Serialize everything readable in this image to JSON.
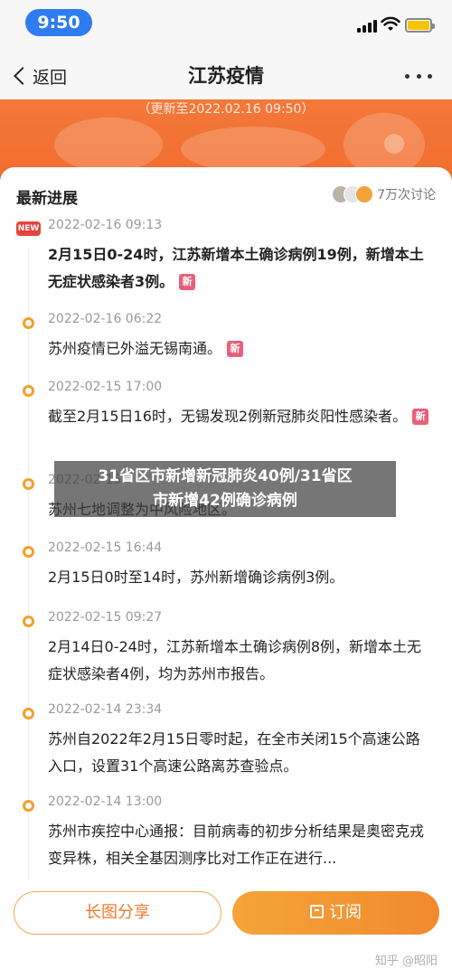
{
  "status_bar": {
    "time": "9:50"
  },
  "nav": {
    "back_label": "返回",
    "title": "江苏疫情"
  },
  "header": {
    "update_note": "（更新至2022.02.16 09:50）"
  },
  "card": {
    "title": "最新进展",
    "discussion_count": "7万次讨论",
    "entries": [
      {
        "time": "2022-02-16 09:13",
        "text": "2月15日0-24时，江苏新增本土确诊病例19例，新增本土无症状感染者3例。",
        "marker": "NEW",
        "badge": "新",
        "bold": true
      },
      {
        "time": "2022-02-16 06:22",
        "text": "苏州疫情已外溢无锡南通。",
        "badge": "新"
      },
      {
        "time": "2022-02-15 17:00",
        "text": "截至2月15日16时，无锡发现2例新冠肺炎阳性感染者。",
        "badge": "新"
      },
      {
        "time": "2022-02-15",
        "text": "苏州七地调整为中风险地区。"
      },
      {
        "time": "2022-02-15 16:44",
        "text": "2月15日0时至14时，苏州新增确诊病例3例。"
      },
      {
        "time": "2022-02-15 09:27",
        "text": "2月14日0-24时，江苏新增本土确诊病例8例，新增本土无症状感染者4例，均为苏州市报告。"
      },
      {
        "time": "2022-02-14 23:34",
        "text": "苏州自2022年2月15日零时起，在全市关闭15个高速公路入口，设置31个高速公路离苏查验点。"
      },
      {
        "time": "2022-02-14 13:00",
        "text": "苏州市疾控中心通报：目前病毒的初步分析结果是奥密克戎变异株，相关全基因测序比对工作正在进行..."
      }
    ]
  },
  "overlay": {
    "headline_line1": "31省区市新增新冠肺炎40例/31省区",
    "headline_line2": "市新增42例确诊病例"
  },
  "bottom": {
    "share_label": "长图分享",
    "subscribe_label": "订阅",
    "watermark": "知乎 @昭阳"
  },
  "colors": {
    "accent_orange": "#f06a2b",
    "dot_orange": "#f4a02a",
    "new_red": "#e8433b",
    "blue_pill": "#2f7bf0"
  },
  "icons": [
    "signal-icon",
    "wifi-icon",
    "battery-icon",
    "back-chevron-icon",
    "more-icon",
    "subscribe-icon"
  ]
}
